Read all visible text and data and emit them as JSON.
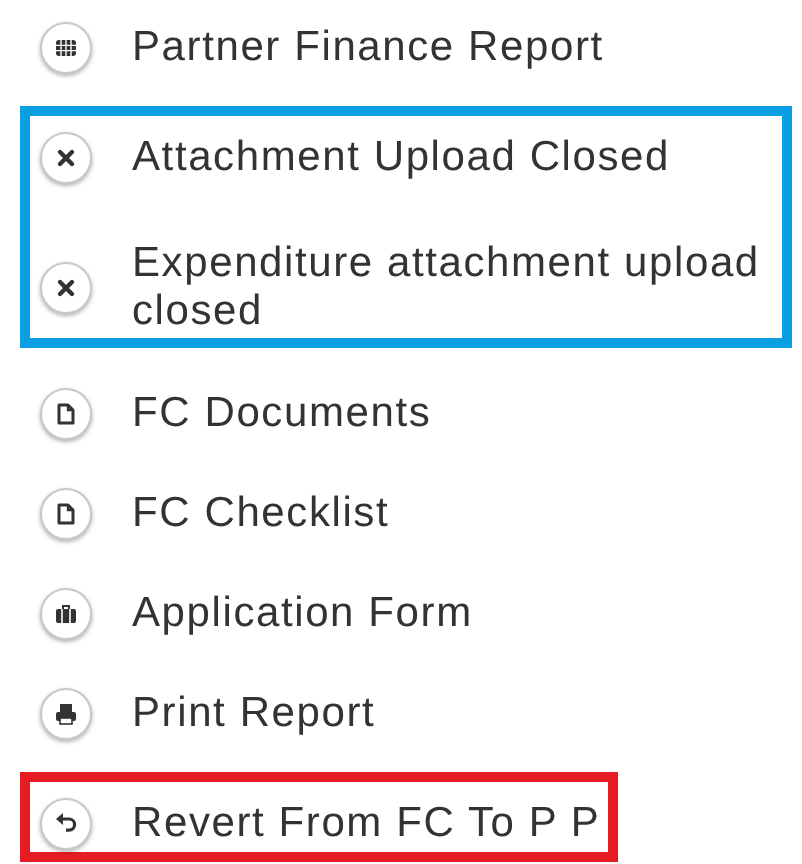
{
  "groups": [
    {
      "items": [
        {
          "kind": "report",
          "label": "Partner Finance Report"
        }
      ]
    },
    {
      "color": "#0a9fe3",
      "items": [
        {
          "kind": "closed",
          "label": "Attachment Upload Closed"
        },
        {
          "kind": "closed",
          "label": "Expenditure attachment upload closed"
        }
      ]
    },
    {
      "items": [
        {
          "kind": "document",
          "label": "FC Documents"
        },
        {
          "kind": "document",
          "label": "FC Checklist"
        },
        {
          "kind": "form",
          "label": "Application Form"
        },
        {
          "kind": "print",
          "label": "Print Report"
        }
      ]
    },
    {
      "color": "#e61c24",
      "items": [
        {
          "kind": "revert",
          "label": "Revert From FC To P P"
        }
      ]
    }
  ]
}
